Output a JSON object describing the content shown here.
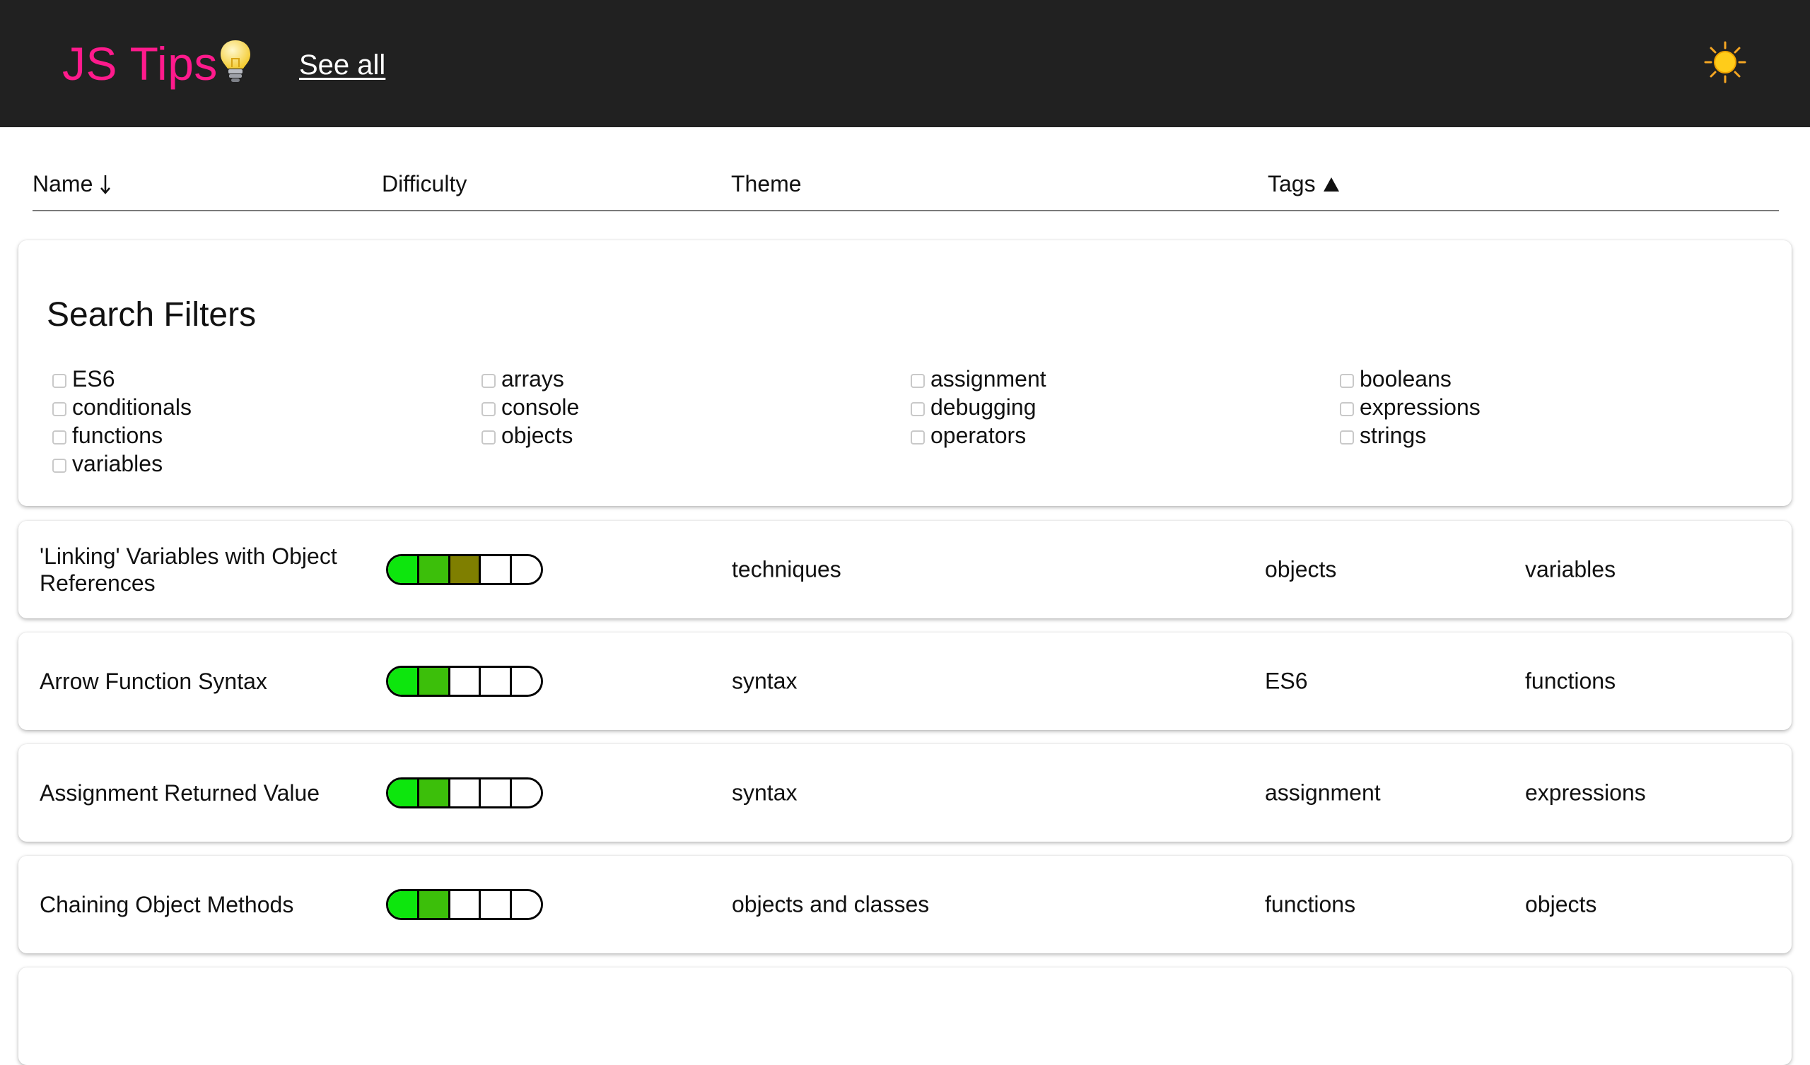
{
  "header": {
    "brand": "JS Tips",
    "see_all": "See all"
  },
  "columns": {
    "name": "Name",
    "difficulty": "Difficulty",
    "theme": "Theme",
    "tags": "Tags"
  },
  "filters": {
    "title": "Search Filters",
    "col1": [
      "ES6",
      "conditionals",
      "functions",
      "variables"
    ],
    "col2": [
      "arrays",
      "console",
      "objects"
    ],
    "col3": [
      "assignment",
      "debugging",
      "operators"
    ],
    "col4": [
      "booleans",
      "expressions",
      "strings"
    ]
  },
  "tips": [
    {
      "name": "'Linking' Variables with Object References",
      "difficulty": 3,
      "difficulty_max": 5,
      "theme": "techniques",
      "tag1": "objects",
      "tag2": "variables"
    },
    {
      "name": "Arrow Function Syntax",
      "difficulty": 2,
      "difficulty_max": 5,
      "theme": "syntax",
      "tag1": "ES6",
      "tag2": "functions"
    },
    {
      "name": "Assignment Returned Value",
      "difficulty": 2,
      "difficulty_max": 5,
      "theme": "syntax",
      "tag1": "assignment",
      "tag2": "expressions"
    },
    {
      "name": "Chaining Object Methods",
      "difficulty": 2,
      "difficulty_max": 5,
      "theme": "objects and classes",
      "tag1": "functions",
      "tag2": "objects"
    }
  ],
  "colors": {
    "brand": "#ff1a8c",
    "topbar": "#212121",
    "difficulty_1": "#0de60d",
    "difficulty_2": "#3cbf0a",
    "difficulty_3": "#7f7f00"
  },
  "icons": {
    "brand_icon": "light-bulb-icon",
    "theme_toggle": "sun-icon",
    "name_sort": "arrow-down-icon",
    "tags_sort": "triangle-up-icon"
  }
}
